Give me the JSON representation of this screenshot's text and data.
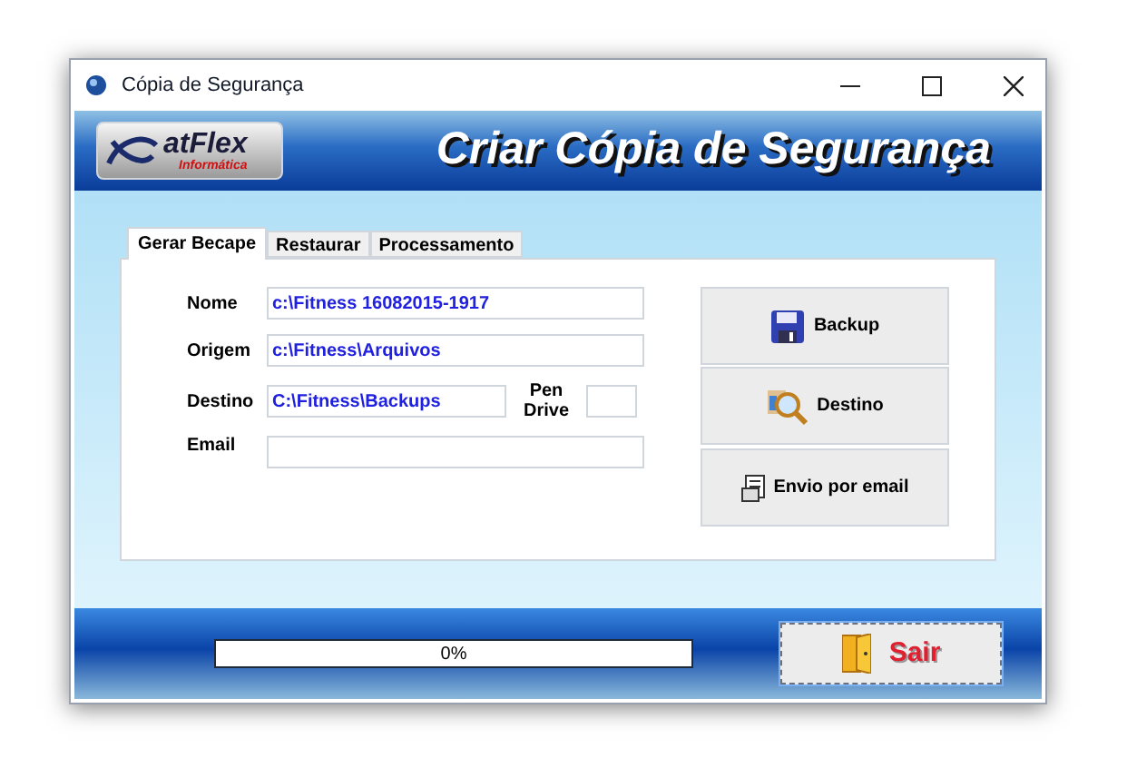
{
  "window": {
    "title": "Cópia de Segurança"
  },
  "logo": {
    "name": "atFlex",
    "subtitle": "Informática"
  },
  "header": {
    "title": "Criar Cópia de Segurança"
  },
  "tabs": [
    {
      "label": "Gerar Becape",
      "selected": true
    },
    {
      "label": "Restaurar",
      "selected": false
    },
    {
      "label": "Processamento",
      "selected": false
    }
  ],
  "form": {
    "nome": {
      "label": "Nome",
      "value": "c:\\Fitness 16082015-1917"
    },
    "origem": {
      "label": "Origem",
      "value": "c:\\Fitness\\Arquivos"
    },
    "destino": {
      "label": "Destino",
      "value": "C:\\Fitness\\Backups"
    },
    "pen_drive": {
      "label": "Pen Drive"
    },
    "email": {
      "label": "Email"
    }
  },
  "actions": [
    {
      "kind": "save",
      "label": "Backup"
    },
    {
      "kind": "search",
      "label": "Destino"
    },
    {
      "kind": "mail",
      "label": "Envio por email"
    }
  ],
  "progress": {
    "level": 0,
    "text": "0%"
  },
  "exit_button": {
    "label": "Sair"
  }
}
